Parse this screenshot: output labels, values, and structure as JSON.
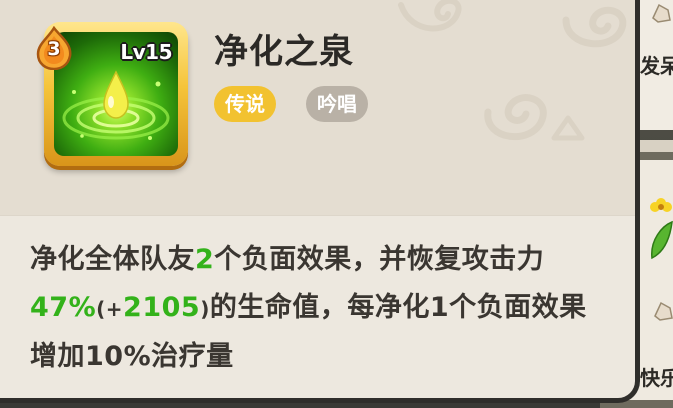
{
  "skill": {
    "name": "净化之泉",
    "level": "Lv15",
    "star_count": "3",
    "icon": "green-spring-droplet-icon",
    "tags": {
      "rarity": "传说",
      "type": "吟唱"
    }
  },
  "description": {
    "p1": "净化全体队友",
    "n1": "2",
    "p2": "个负面效果，并恢复攻击力",
    "n2": "47%",
    "paren_open": "(+",
    "n3": "2105",
    "paren_close": ")",
    "p3": "的生命值，每净化1个负面效果增加10%治疗量"
  },
  "background": {
    "text_top": "发呆",
    "text_bottom": "快乐"
  },
  "colors": {
    "rarity_tag": "#f2c230",
    "type_tag": "#b9b1a6",
    "highlight": "#33b21a",
    "icon_frame": "#f5c43a"
  }
}
